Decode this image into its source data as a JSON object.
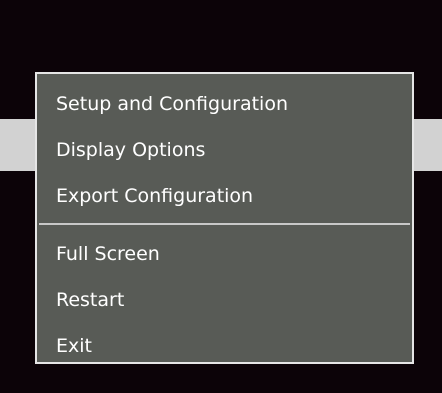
{
  "context_menu": {
    "groups": [
      {
        "items": [
          {
            "label": "Setup and Configuration"
          },
          {
            "label": "Display Options"
          },
          {
            "label": "Export Configuration"
          }
        ]
      },
      {
        "items": [
          {
            "label": "Full Screen"
          },
          {
            "label": "Restart"
          },
          {
            "label": "Exit"
          }
        ]
      }
    ]
  },
  "colors": {
    "window_background": "#0c0308",
    "background_strip": "#d2d2d2",
    "menu_background": "#585b56",
    "menu_border": "#e6e6e6",
    "menu_text": "#ffffff",
    "separator": "#c8c8c8"
  }
}
